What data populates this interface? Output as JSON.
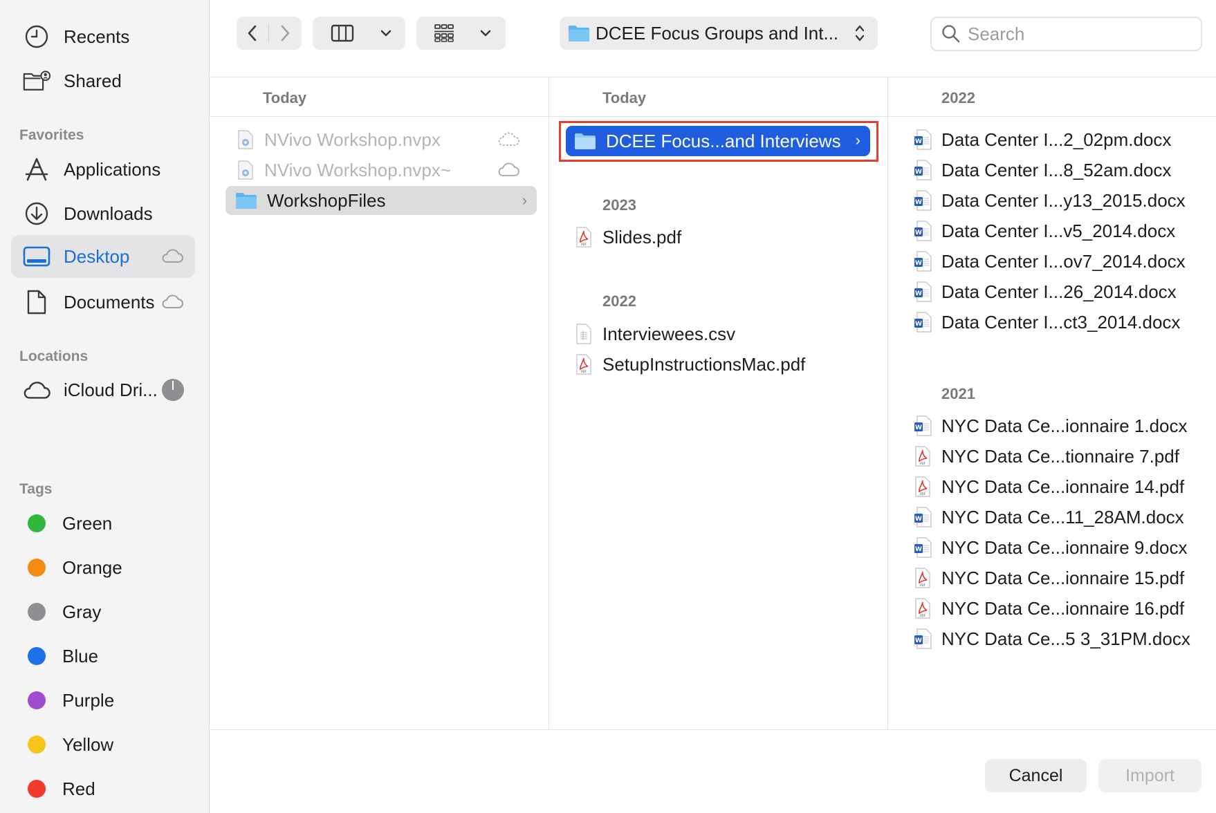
{
  "sidebar": {
    "items": [
      {
        "label": "Recents",
        "icon": "clock-icon"
      },
      {
        "label": "Shared",
        "icon": "shared-folder-icon"
      }
    ],
    "favorites_header": "Favorites",
    "favorites": [
      {
        "label": "Applications",
        "icon": "applications-icon"
      },
      {
        "label": "Downloads",
        "icon": "download-icon"
      },
      {
        "label": "Desktop",
        "icon": "desktop-icon",
        "selected": true
      },
      {
        "label": "Documents",
        "icon": "document-icon"
      }
    ],
    "locations_header": "Locations",
    "locations": [
      {
        "label": "iCloud Dri...",
        "icon": "cloud-icon"
      }
    ],
    "tags_header": "Tags",
    "tags": [
      {
        "label": "Green",
        "color": "#2fb83c"
      },
      {
        "label": "Orange",
        "color": "#f28a14"
      },
      {
        "label": "Gray",
        "color": "#8e8e93"
      },
      {
        "label": "Blue",
        "color": "#1f6fe8"
      },
      {
        "label": "Purple",
        "color": "#a04cd0"
      },
      {
        "label": "Yellow",
        "color": "#f5c518"
      },
      {
        "label": "Red",
        "color": "#f23a2e"
      }
    ]
  },
  "toolbar": {
    "path_label": "DCEE Focus Groups and Int...",
    "search_placeholder": "Search"
  },
  "columns": [
    {
      "header": "Today",
      "rows": [
        {
          "name": "NVivo Workshop.nvpx",
          "icon": "nvivo-file-icon",
          "dim": true
        },
        {
          "name": "NVivo Workshop.nvpx~",
          "icon": "nvivo-file-icon",
          "dim": true
        },
        {
          "name": "WorkshopFiles",
          "icon": "folder-icon",
          "selected": "gray"
        }
      ]
    },
    {
      "header": "Today",
      "rows": [
        {
          "name": "DCEE Focus...and Interviews",
          "icon": "folder-icon",
          "selected": "blue"
        }
      ],
      "groups": [
        {
          "label": "2023",
          "rows": [
            {
              "name": "Slides.pdf",
              "icon": "pdf-icon"
            }
          ]
        },
        {
          "label": "2022",
          "rows": [
            {
              "name": "Interviewees.csv",
              "icon": "csv-icon"
            },
            {
              "name": "SetupInstructionsMac.pdf",
              "icon": "pdf-icon"
            }
          ]
        }
      ]
    },
    {
      "header": "2022",
      "rows": [
        {
          "name": "Data Center I...2_02pm.docx",
          "icon": "word-icon"
        },
        {
          "name": "Data Center I...8_52am.docx",
          "icon": "word-icon"
        },
        {
          "name": "Data Center I...y13_2015.docx",
          "icon": "word-icon"
        },
        {
          "name": "Data Center I...v5_2014.docx",
          "icon": "word-icon"
        },
        {
          "name": "Data Center I...ov7_2014.docx",
          "icon": "word-icon"
        },
        {
          "name": "Data Center I...26_2014.docx",
          "icon": "word-icon"
        },
        {
          "name": "Data Center I...ct3_2014.docx",
          "icon": "word-icon"
        }
      ],
      "groups": [
        {
          "label": "2021",
          "rows": [
            {
              "name": "NYC Data Ce...ionnaire 1.docx",
              "icon": "word-icon"
            },
            {
              "name": "NYC Data Ce...tionnaire 7.pdf",
              "icon": "pdf-icon"
            },
            {
              "name": "NYC Data Ce...ionnaire 14.pdf",
              "icon": "pdf-icon"
            },
            {
              "name": "NYC Data Ce...11_28AM.docx",
              "icon": "word-icon"
            },
            {
              "name": "NYC Data Ce...ionnaire 9.docx",
              "icon": "word-icon"
            },
            {
              "name": "NYC Data Ce...ionnaire 15.pdf",
              "icon": "pdf-icon"
            },
            {
              "name": "NYC Data Ce...ionnaire 16.pdf",
              "icon": "pdf-icon"
            },
            {
              "name": "NYC Data Ce...5 3_31PM.docx",
              "icon": "word-icon"
            }
          ]
        }
      ]
    }
  ],
  "buttons": {
    "cancel": "Cancel",
    "import": "Import"
  }
}
